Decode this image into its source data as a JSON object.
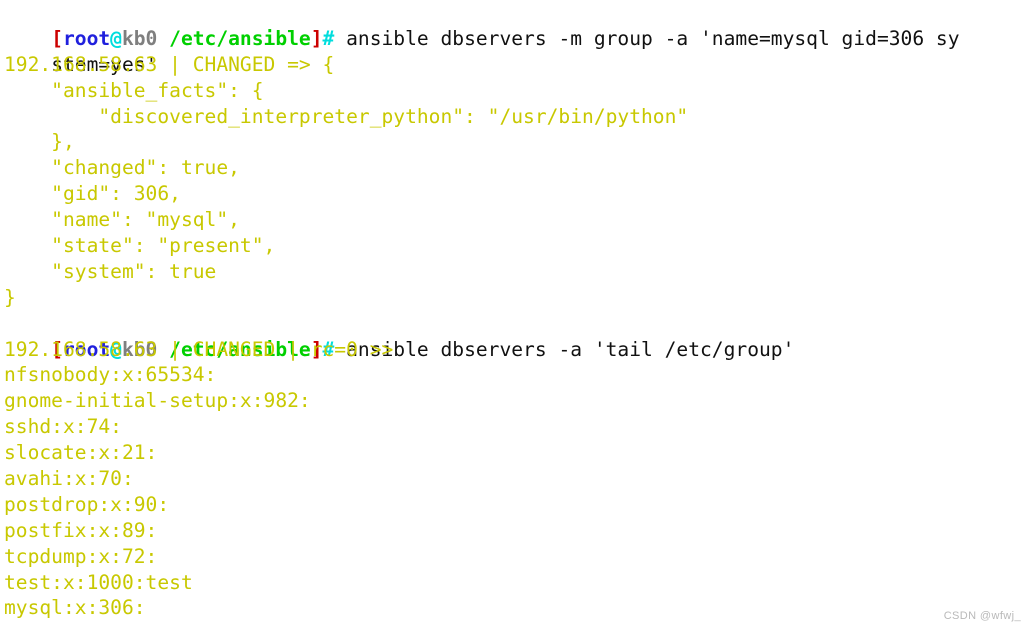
{
  "terminal": {
    "background_color": "#ffffff",
    "palette": {
      "bracket_red": "#cc0000",
      "user_blue": "#2020dd",
      "at_cyan": "#00dddd",
      "host_gray": "#7f7f7f",
      "path_green": "#00d000",
      "command_black": "#111111",
      "output_yellow": "#c8c800"
    },
    "prompt": {
      "open_bracket": "[",
      "user": "root",
      "at": "@",
      "host": "kb0",
      "space": " ",
      "path": "/etc/ansible",
      "close_bracket": "]",
      "hash": "#"
    },
    "lines": [
      {
        "type": "prompt",
        "command": " ansible dbservers -m group -a 'name=mysql gid=306 sy"
      },
      {
        "type": "command-wrap",
        "text": "stem=yes'"
      },
      {
        "type": "output",
        "text": "192.168.58.63 | CHANGED => {"
      },
      {
        "type": "output",
        "text": "    \"ansible_facts\": {"
      },
      {
        "type": "output",
        "text": "        \"discovered_interpreter_python\": \"/usr/bin/python\""
      },
      {
        "type": "output",
        "text": "    },"
      },
      {
        "type": "output",
        "text": "    \"changed\": true,"
      },
      {
        "type": "output",
        "text": "    \"gid\": 306,"
      },
      {
        "type": "output",
        "text": "    \"name\": \"mysql\","
      },
      {
        "type": "output",
        "text": "    \"state\": \"present\","
      },
      {
        "type": "output",
        "text": "    \"system\": true"
      },
      {
        "type": "output",
        "text": "}"
      },
      {
        "type": "prompt",
        "command": " ansible dbservers -a 'tail /etc/group'"
      },
      {
        "type": "output",
        "text": "192.168.58.63 | CHANGED | rc=0 >>"
      },
      {
        "type": "output",
        "text": "nfsnobody:x:65534:"
      },
      {
        "type": "output",
        "text": "gnome-initial-setup:x:982:"
      },
      {
        "type": "output",
        "text": "sshd:x:74:"
      },
      {
        "type": "output",
        "text": "slocate:x:21:"
      },
      {
        "type": "output",
        "text": "avahi:x:70:"
      },
      {
        "type": "output",
        "text": "postdrop:x:90:"
      },
      {
        "type": "output",
        "text": "postfix:x:89:"
      },
      {
        "type": "output",
        "text": "tcpdump:x:72:"
      },
      {
        "type": "output",
        "text": "test:x:1000:test"
      },
      {
        "type": "output",
        "text": "mysql:x:306:"
      }
    ],
    "watermark": "CSDN @wfwj_"
  }
}
